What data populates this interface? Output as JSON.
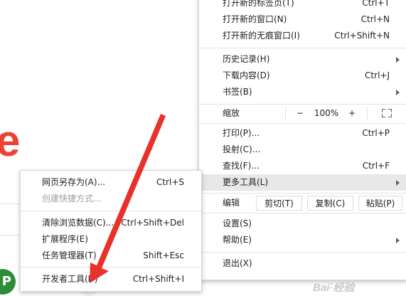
{
  "background": {
    "logo_letter": "e",
    "avatar_letter": "P"
  },
  "main_menu": {
    "new_tab": {
      "label": "打开新的标签页(T)",
      "shortcut": "Ctrl+T"
    },
    "new_window": {
      "label": "打开新的窗口(N)",
      "shortcut": "Ctrl+N"
    },
    "new_incognito": {
      "label": "打开新的无痕窗口(I)",
      "shortcut": "Ctrl+Shift+N"
    },
    "history": {
      "label": "历史记录(H)"
    },
    "downloads": {
      "label": "下载内容(D)",
      "shortcut": "Ctrl+J"
    },
    "bookmarks": {
      "label": "书签(B)"
    },
    "zoom": {
      "label": "缩放",
      "minus": "−",
      "level": "100%",
      "plus": "+"
    },
    "print": {
      "label": "打印(P)...",
      "shortcut": "Ctrl+P"
    },
    "cast": {
      "label": "投射(C)..."
    },
    "find": {
      "label": "查找(F)...",
      "shortcut": "Ctrl+F"
    },
    "more_tools": {
      "label": "更多工具(L)"
    },
    "edit": {
      "label": "编辑",
      "cut": "剪切(T)",
      "copy": "复制(C)",
      "paste": "粘贴(P)"
    },
    "settings": {
      "label": "设置(S)"
    },
    "help": {
      "label": "帮助(E)"
    },
    "exit": {
      "label": "退出(X)"
    }
  },
  "sub_menu": {
    "save_page": {
      "label": "网页另存为(A)...",
      "shortcut": "Ctrl+S"
    },
    "create_shortcut": {
      "label": "创建快捷方式..."
    },
    "clear_data": {
      "label": "清除浏览数据(C)...",
      "shortcut": "Ctrl+Shift+Del"
    },
    "extensions": {
      "label": "扩展程序(E)"
    },
    "task_manager": {
      "label": "任务管理器(T)",
      "shortcut": "Shift+Esc"
    },
    "dev_tools": {
      "label": "开发者工具(D)",
      "shortcut": "Ctrl+Shift+I"
    }
  },
  "annotation": {
    "arrow_color": "#e8312a"
  },
  "colors": {
    "highlight": "#e8e8e8",
    "logo": "#ea4335",
    "avatar": "#2e8b3a"
  }
}
